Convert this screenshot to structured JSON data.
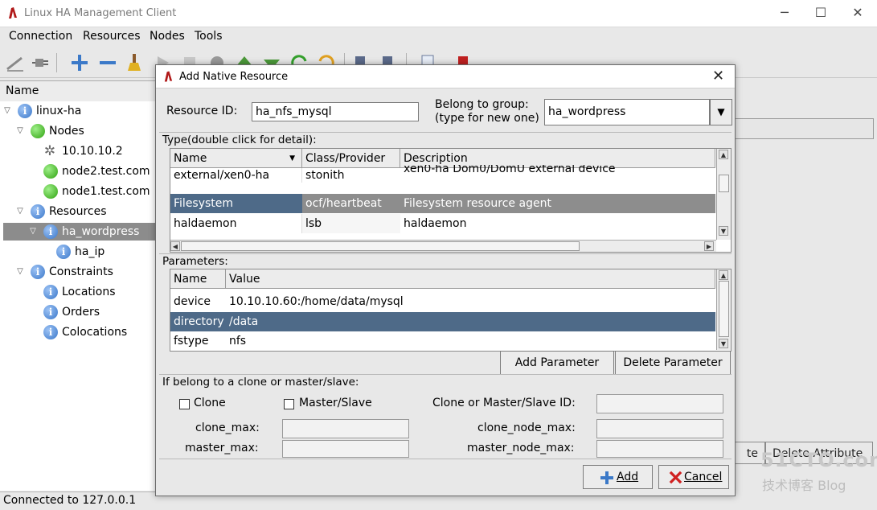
{
  "window": {
    "title": "Linux HA Management Client"
  },
  "menus": [
    "Connection",
    "Resources",
    "Nodes",
    "Tools"
  ],
  "tree": {
    "header": "Name",
    "items": [
      "linux-ha",
      "Nodes",
      "10.10.10.2",
      "node2.test.com",
      "node1.test.com",
      "Resources",
      "ha_wordpress",
      "ha_ip",
      "Constraints",
      "Locations",
      "Orders",
      "Colocations"
    ]
  },
  "status_bar": "Connected to 127.0.0.1",
  "background_buttons": [
    "te",
    "Delete Attribute"
  ],
  "dialog": {
    "title": "Add Native Resource",
    "resource_id_label": "Resource ID:",
    "resource_id_value": "ha_nfs_mysql",
    "group_label_1": "Belong to group:",
    "group_label_2": "(type for new one)",
    "group_value": "ha_wordpress",
    "type_section": "Type(double click for detail):",
    "type_columns": [
      "Name",
      "Class/Provider",
      "Description"
    ],
    "type_rows": [
      [
        "external/xen0-ha",
        "stonith",
        "xen0-ha Dom0/DomU external device"
      ],
      [
        "Filesystem",
        "ocf/heartbeat",
        "Filesystem resource agent"
      ],
      [
        "haldaemon",
        "lsb",
        "haldaemon"
      ]
    ],
    "params_section": "Parameters:",
    "param_columns": [
      "Name",
      "Value"
    ],
    "param_rows": [
      [
        "device",
        "10.10.10.60:/home/data/mysql"
      ],
      [
        "directory",
        "/data"
      ],
      [
        "fstype",
        "nfs"
      ]
    ],
    "add_param_label": "Add Parameter",
    "delete_param_label": "Delete Parameter",
    "clone_section": "If belong to a clone or master/slave:",
    "clone_label": "Clone",
    "master_slave_label": "Master/Slave",
    "clone_ms_id_label": "Clone or Master/Slave ID:",
    "clone_max_label": "clone_max:",
    "master_max_label": "master_max:",
    "clone_node_max_label": "clone_node_max:",
    "master_node_max_label": "master_node_max:",
    "add_label": "Add",
    "cancel_label": "Cancel"
  },
  "watermark": {
    "line1": "51CTO.com",
    "line2": "技术博客  Blog"
  }
}
